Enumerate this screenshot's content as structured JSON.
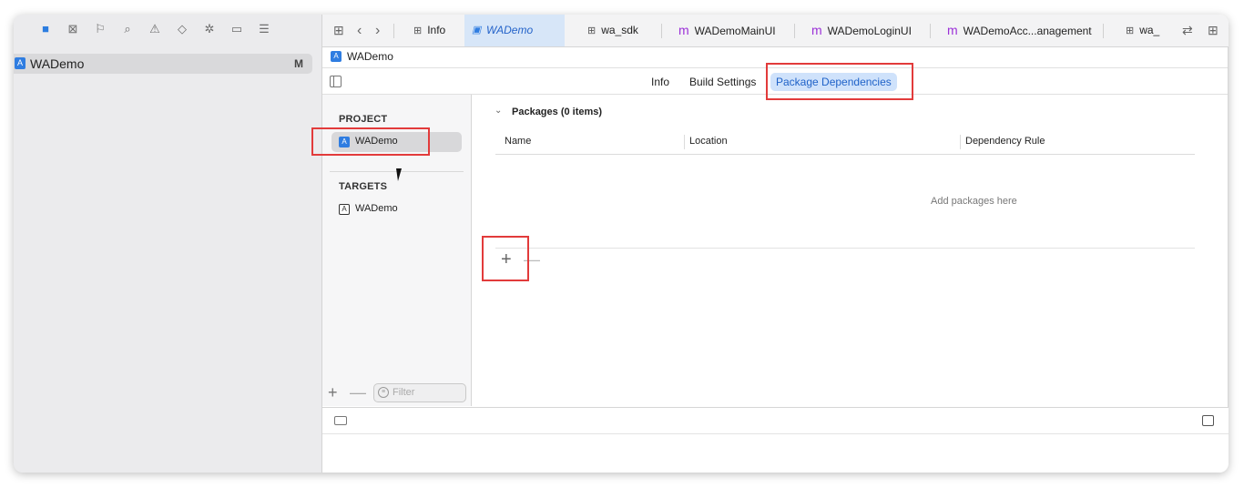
{
  "navigator": {
    "toolbar_icons": [
      "folder-icon",
      "source-control-icon",
      "bookmark-icon",
      "search-icon",
      "warning-icon",
      "test-icon",
      "debug-icon",
      "breakpoint-icon",
      "report-icon"
    ],
    "project_row": {
      "label": "WADemo",
      "badge": "M"
    }
  },
  "tabs": [
    {
      "label": "Info",
      "icon": "grid-icon"
    },
    {
      "label": "WADemo",
      "icon": "app-icon",
      "active": true
    },
    {
      "label": "wa_sdk",
      "icon": "grid-icon"
    },
    {
      "label": "WADemoMainUI",
      "icon": "m"
    },
    {
      "label": "WADemoLoginUI",
      "icon": "m"
    },
    {
      "label": "WADemoAcc...anagement",
      "icon": "m"
    },
    {
      "label": "wa_",
      "icon": "grid-icon"
    }
  ],
  "jumpbar": {
    "label": "WADemo"
  },
  "segments": {
    "info": "Info",
    "build_settings": "Build Settings",
    "package_dependencies": "Package Dependencies"
  },
  "project_list": {
    "project_header": "PROJECT",
    "project_item": "WADemo",
    "targets_header": "TARGETS",
    "target_item": "WADemo",
    "filter_placeholder": "Filter"
  },
  "packages": {
    "title": "Packages (0 items)",
    "columns": [
      "Name",
      "Location",
      "Dependency Rule"
    ],
    "empty_text": "Add packages here",
    "add_symbol": "+",
    "remove_symbol": "—"
  }
}
